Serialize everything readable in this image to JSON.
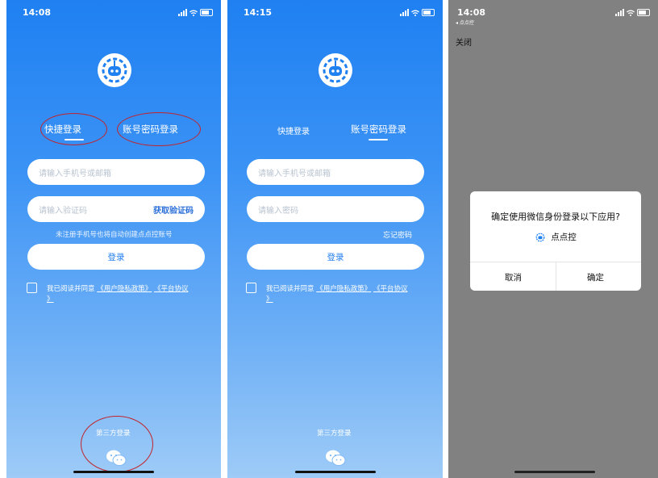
{
  "screens": [
    {
      "time": "14:08",
      "tabs": [
        "快捷登录",
        "账号密码登录"
      ],
      "phone_placeholder": "请输入手机号或邮箱",
      "code_placeholder": "请输入验证码",
      "get_code": "获取验证码",
      "hint": "未注册手机号也将自动创建点点控账号",
      "login": "登录",
      "agree_prefix": "我已阅读并同意",
      "privacy": "《用户隐私政策》",
      "platform": "《平台协议",
      "platform_end": "》",
      "third_party": "第三方登录"
    },
    {
      "time": "14:15",
      "tabs": [
        "快捷登录",
        "账号密码登录"
      ],
      "phone_placeholder": "请输入手机号或邮箱",
      "password_placeholder": "请输入密码",
      "forgot": "忘记密码",
      "login": "登录",
      "agree_prefix": "我已阅读并同意",
      "privacy": "《用户隐私政策》",
      "platform": "《平台协议",
      "platform_end": "》",
      "third_party": "第三方登录"
    },
    {
      "time": "14:08",
      "back_app": "◂ 点点控",
      "close": "关闭",
      "dialog": {
        "title": "确定使用微信身份登录以下应用?",
        "app_name": "点点控",
        "cancel": "取消",
        "confirm": "确定"
      }
    }
  ],
  "colors": {
    "gradient_top": "#1f80f2",
    "gradient_bottom": "#9ecbf7",
    "annotation": "#c2242b",
    "link_blue": "#2b6fd8"
  },
  "icons": [
    "robot-logo-icon",
    "wechat-icon",
    "signal-icon",
    "wifi-icon",
    "battery-icon"
  ]
}
